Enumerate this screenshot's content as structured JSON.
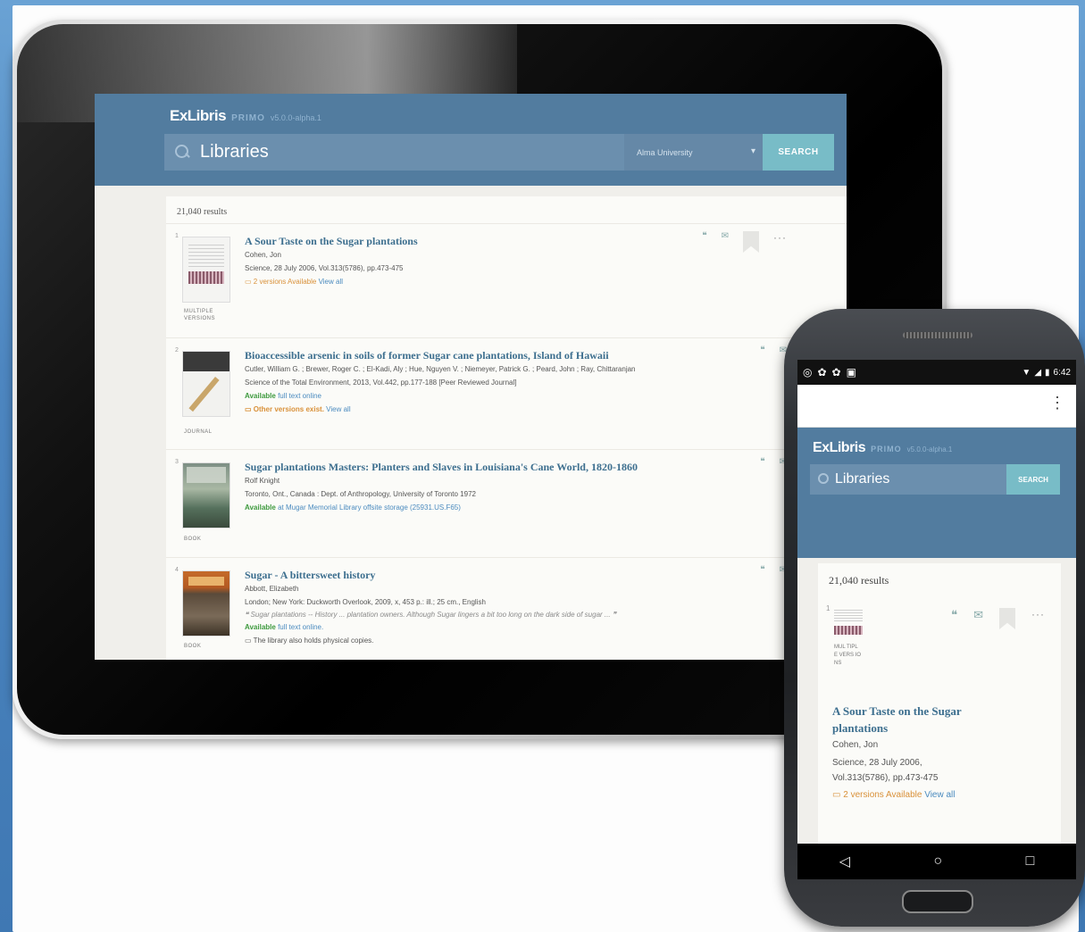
{
  "brand": {
    "name": "ExLibris",
    "product": "PRIMO",
    "version": "v5.0.0-alpha.1"
  },
  "search": {
    "query": "Libraries",
    "scope": "Alma University",
    "button": "SEARCH"
  },
  "results_count": "21,040 results",
  "records": [
    {
      "index": "1",
      "type": "MULTIPLE VERSIONS",
      "title": "A Sour Taste on the Sugar plantations",
      "author": "Cohen, Jon",
      "source": "Science, 28 July 2006, Vol.313(5786), pp.473-475",
      "status": "2 versions Available",
      "status_link": "View all"
    },
    {
      "index": "2",
      "type": "JOURNAL",
      "title": "Bioaccessible arsenic in soils of former Sugar cane plantations, Island of Hawaii",
      "author": "Cutler, William G. ; Brewer, Roger C. ; El-Kadi, Aly ; Hue, Nguyen V. ; Niemeyer, Patrick G. ; Peard, John ; Ray, Chittaranjan",
      "source": "Science of the Total Environment, 2013, Vol.442, pp.177-188 [Peer Reviewed Journal]",
      "available": "Available",
      "available_link": "full text online",
      "status": "Other versions exist.",
      "status_link": "View all"
    },
    {
      "index": "3",
      "type": "BOOK",
      "title": "Sugar plantations Masters: Planters and Slaves in Louisiana's Cane World, 1820-1860",
      "author": "Rolf Knight",
      "source": "Toronto, Ont., Canada : Dept. of Anthropology, University of Toronto 1972",
      "available": "Available",
      "available_link": "at Mugar Memorial Library offsite storage (25931.US.F65)"
    },
    {
      "index": "4",
      "type": "BOOK",
      "title": "Sugar - A bittersweet history",
      "author": "Abbott, Elizabeth",
      "source": "London; New York: Duckworth Overlook, 2009, x, 453 p.: ill.; 25 cm., English",
      "snippet": "Sugar plantations -- History ... plantation owners. Although Sugar lingers a bit too long on the dark side of sugar ...",
      "available": "Available",
      "available_link": "full text online.",
      "holdings": "The library also holds physical copies."
    }
  ],
  "phone": {
    "status_time": "6:42",
    "record": {
      "index": "1",
      "type": "MUL TIPL E VERS IONS",
      "title": "A Sour Taste on the Sugar plantations",
      "author": "Cohen, Jon",
      "source_line1": "Science, 28 July 2006,",
      "source_line2": "Vol.313(5786), pp.473-475",
      "status": "2 versions Available",
      "status_link": "View all"
    }
  },
  "icons": {
    "cite": "cite-icon",
    "email": "email-icon",
    "bookmark": "bookmark-icon",
    "more": "more-icon",
    "search": "search-icon"
  },
  "colors": {
    "header": "#527c9f",
    "search_bg": "#6b8fae",
    "search_button": "#78bcc7",
    "title": "#3d6f8f",
    "available": "#3e9a3e",
    "versions": "#d9913a"
  }
}
